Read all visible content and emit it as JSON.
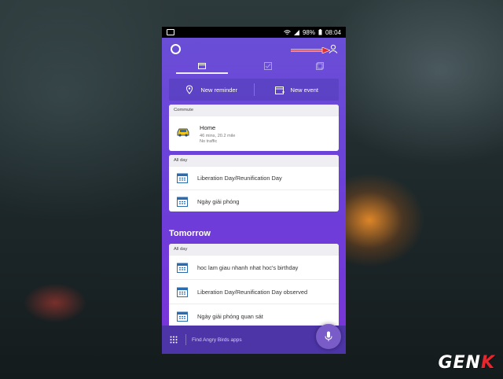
{
  "status_bar": {
    "battery": "98%",
    "time": "08:04"
  },
  "quick_actions": {
    "new_reminder": "New reminder",
    "new_event": "New event"
  },
  "commute": {
    "header": "Commute",
    "title": "Home",
    "details": "46 mins, 20.2 mile",
    "traffic": "No traffic"
  },
  "today_allday": {
    "header": "All day",
    "items": [
      "Liberation Day/Reunification Day",
      "Ngày giải phóng"
    ]
  },
  "tomorrow": {
    "title": "Tomorrow",
    "header": "All day",
    "items": [
      "hoc lam giau nhanh nhat hoc's birthday",
      "Liberation Day/Reunification Day observed",
      "Ngày giải phóng quan sát"
    ]
  },
  "search": {
    "placeholder": "Find Angry Birds apps"
  },
  "watermark": {
    "text_a": "GEN",
    "text_b": "K"
  },
  "colors": {
    "accent": "#6a4fd6",
    "calendar_blue": "#2b6cb0",
    "arrow_red": "#e23030"
  },
  "icons": [
    "image-icon",
    "wifi-icon",
    "signal-icon",
    "battery-icon",
    "cortana-icon",
    "profile-icon",
    "calendar-tab-icon",
    "tasks-tab-icon",
    "notebook-tab-icon",
    "reminder-icon",
    "event-icon",
    "car-icon",
    "calendar-icon",
    "apps-grid-icon",
    "microphone-icon"
  ]
}
